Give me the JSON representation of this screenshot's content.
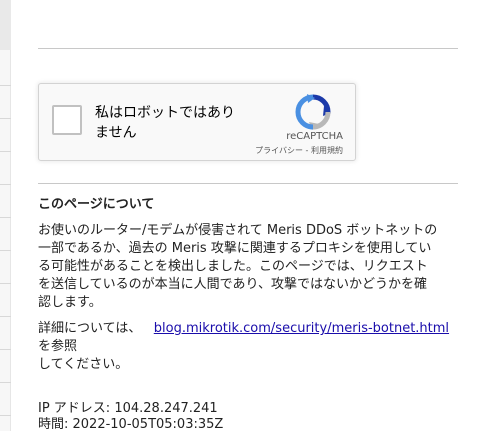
{
  "captcha": {
    "label_line1": "私はロボットではあり",
    "label_line2": "ません",
    "brand": "reCAPTCHA",
    "privacy": "プライバシー",
    "separator": " - ",
    "terms": "利用規約",
    "logo_icon": "recaptcha-logo-icon",
    "colors": {
      "blue": "#4a90e2",
      "dark_blue": "#1c3aa9",
      "gray": "#b8b8b8"
    }
  },
  "about": {
    "title": "このページについて",
    "line1": "お使いのルーター/モデムが侵害されて Meris DDoS ボットネットの",
    "line2": "一部であるか、過去の Meris 攻撃に関連するプロキシを使用してい",
    "line3": "る可能性があることを検出しました。このページでは、リクエスト",
    "line4": "を送信しているのが本当に人間であり、攻撃ではないかどうかを確",
    "line5": "認します。"
  },
  "details": {
    "prefix": "詳細については、",
    "link_text": "blog.mikrotik.com/security/meris-botnet.html",
    "suffix": "を参照",
    "line2": "してください。"
  },
  "info": {
    "ip_label": "IP アドレス: ",
    "ip_value": "104.28.247.241",
    "time_label": "時間: ",
    "time_value": "2022-10-05T05:03:35Z"
  }
}
